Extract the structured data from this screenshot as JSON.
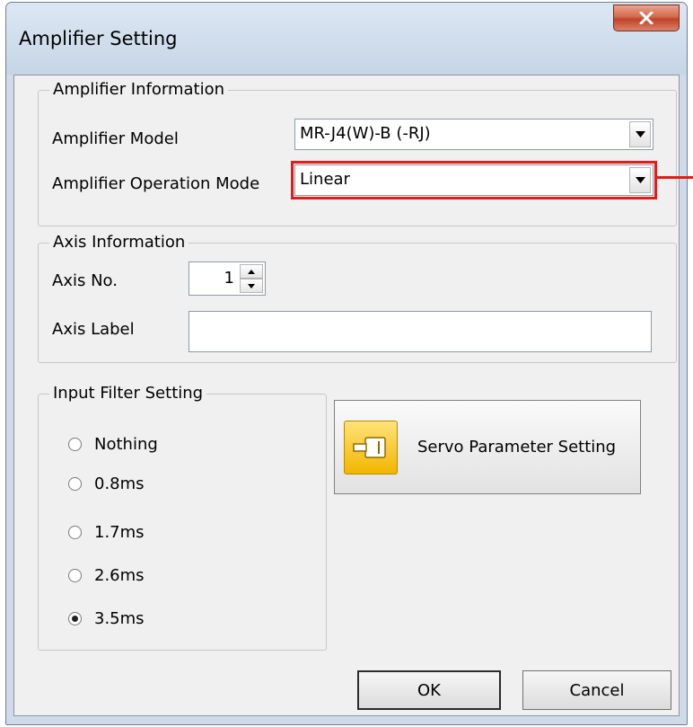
{
  "window": {
    "title": "Amplifier Setting"
  },
  "amplifier_info": {
    "legend": "Amplifier Information",
    "model_label": "Amplifier Model",
    "model_value": "MR-J4(W)-B (-RJ)",
    "mode_label": "Amplifier Operation Mode",
    "mode_value": "Linear"
  },
  "axis_info": {
    "legend": "Axis Information",
    "axis_no_label": "Axis No.",
    "axis_no_value": "1",
    "axis_label_label": "Axis Label",
    "axis_label_value": ""
  },
  "input_filter": {
    "legend": "Input Filter Setting",
    "options": [
      "Nothing",
      "0.8ms",
      "1.7ms",
      "2.6ms",
      "3.5ms"
    ],
    "selected": "3.5ms"
  },
  "buttons": {
    "servo": "Servo Parameter Setting",
    "ok": "OK",
    "cancel": "Cancel"
  },
  "colors": {
    "highlight": "#e41b1b",
    "dialog_bg": "#f0f0f0",
    "frame": "#cfdbe9"
  }
}
